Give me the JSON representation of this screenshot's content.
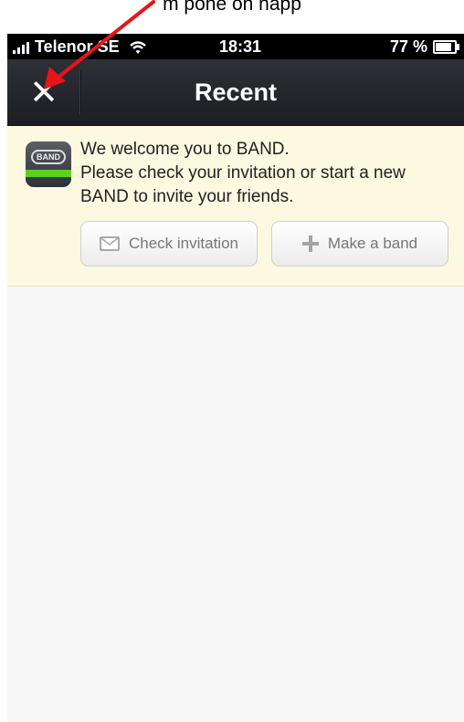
{
  "top_fragment": "m pone on happ",
  "status_bar": {
    "carrier": "Telenor SE",
    "time": "18:31",
    "battery": "77 %",
    "battery_level": 0.77
  },
  "nav": {
    "close_glyph": "✕",
    "title": "Recent"
  },
  "banner": {
    "logo_text": "BAND",
    "line1": "We welcome you to BAND.",
    "line2": "Please check your invitation or start a new",
    "line3": "BAND to invite your friends.",
    "check_button_label": "Check invitation",
    "make_button_label": "Make a band"
  },
  "colors": {
    "nav_background": "#23262b",
    "banner_background": "#fdf8e0",
    "logo_stripe": "#5bd21d",
    "annotation_arrow": "#e8141a"
  },
  "icons": [
    "wifi-icon",
    "battery-icon",
    "close-icon",
    "band-logo-icon",
    "envelope-icon",
    "plus-icon",
    "annotation-arrow"
  ]
}
